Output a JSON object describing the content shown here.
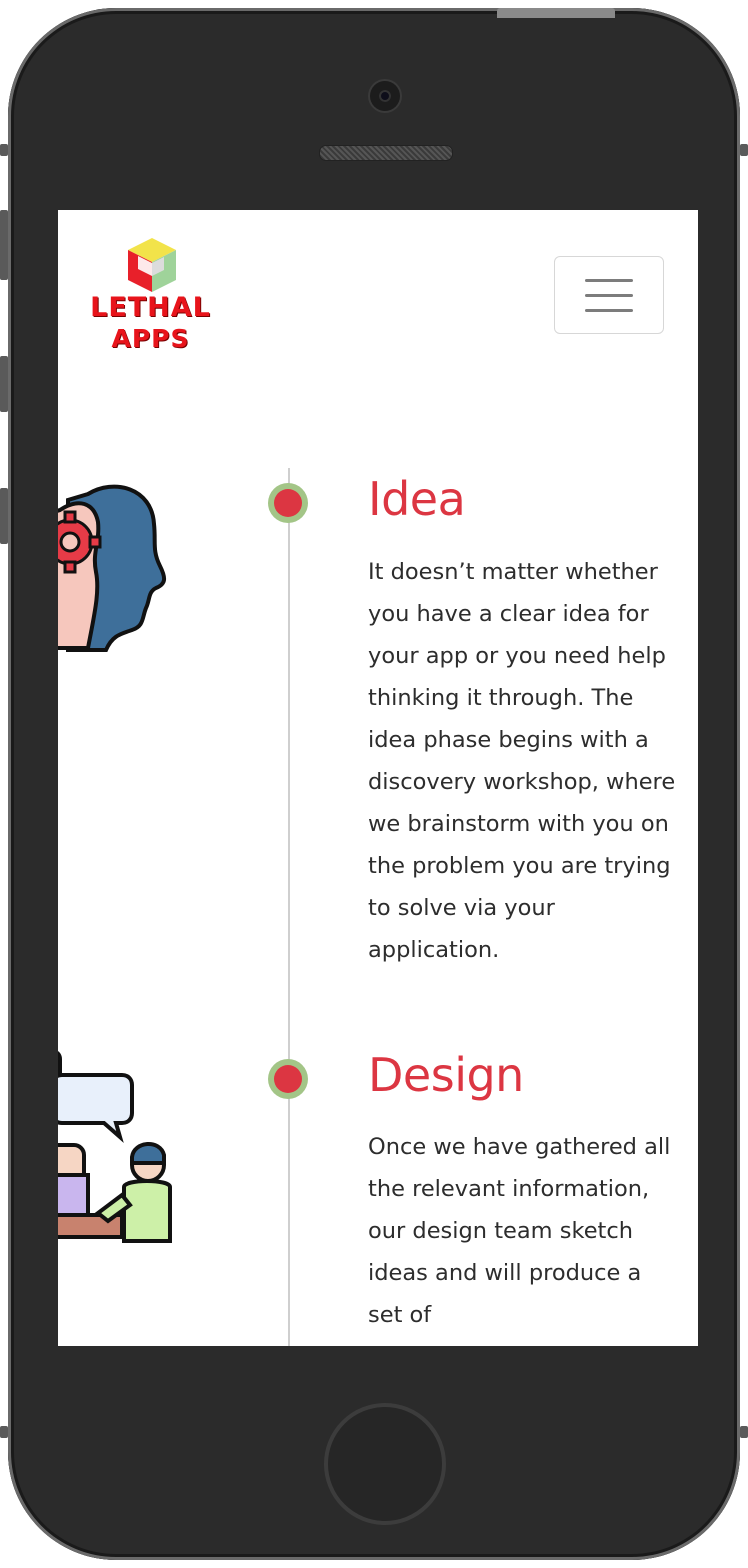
{
  "header": {
    "logo_line1": "LETHAL",
    "logo_line2": "APPS"
  },
  "timeline": {
    "steps": [
      {
        "title": "Idea",
        "text": "It doesn’t matter whether you have a clear idea for your app or you need help thinking it through. The idea phase begins with a discovery workshop, where we brainstorm with you on the problem you are trying to solve via your application.",
        "icon": "brain-gear-icon"
      },
      {
        "title": "Design",
        "text": "Once we have gathered all the relevant information, our design team sketch ideas and will produce a set of",
        "icon": "meeting-discussion-icon"
      }
    ]
  },
  "colors": {
    "accent_red": "#dc3642",
    "dot_ring": "#a3c587",
    "phone_body": "#2b2b2b"
  }
}
